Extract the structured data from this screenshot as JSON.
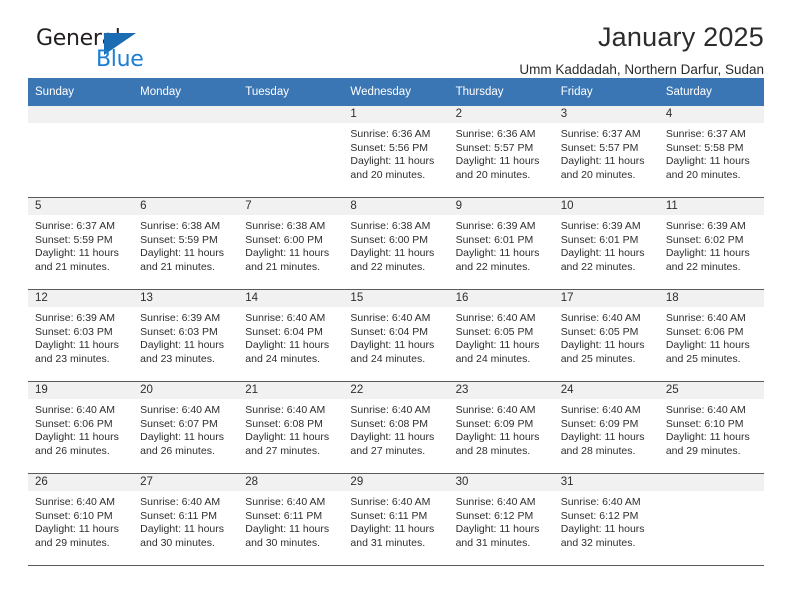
{
  "brand": {
    "line1": "General",
    "line2": "Blue",
    "triangle_icon": "blue-triangle-logo-mark",
    "color_dark": "#231f20",
    "color_blue": "#1b7fd4"
  },
  "header": {
    "title": "January 2025",
    "subtitle": "Umm Kaddadah, Northern Darfur, Sudan"
  },
  "theme": {
    "header_bg": "#3b76b4",
    "header_text": "#ffffff",
    "daynum_band_bg": "#f1f1f1",
    "grid_line": "#5a5a5a",
    "cell_bg": "#ffffff",
    "text": "#2e2e2e"
  },
  "weekday_headers": [
    "Sunday",
    "Monday",
    "Tuesday",
    "Wednesday",
    "Thursday",
    "Friday",
    "Saturday"
  ],
  "labels": {
    "sunrise_prefix": "Sunrise:",
    "sunset_prefix": "Sunset:",
    "daylight_prefix": "Daylight:"
  },
  "weeks": [
    [
      {
        "day": "",
        "empty": true
      },
      {
        "day": "",
        "empty": true
      },
      {
        "day": "",
        "empty": true
      },
      {
        "day": "1",
        "sunrise": "Sunrise: 6:36 AM",
        "sunset": "Sunset: 5:56 PM",
        "daylight_l1": "Daylight: 11 hours",
        "daylight_l2": "and 20 minutes."
      },
      {
        "day": "2",
        "sunrise": "Sunrise: 6:36 AM",
        "sunset": "Sunset: 5:57 PM",
        "daylight_l1": "Daylight: 11 hours",
        "daylight_l2": "and 20 minutes."
      },
      {
        "day": "3",
        "sunrise": "Sunrise: 6:37 AM",
        "sunset": "Sunset: 5:57 PM",
        "daylight_l1": "Daylight: 11 hours",
        "daylight_l2": "and 20 minutes."
      },
      {
        "day": "4",
        "sunrise": "Sunrise: 6:37 AM",
        "sunset": "Sunset: 5:58 PM",
        "daylight_l1": "Daylight: 11 hours",
        "daylight_l2": "and 20 minutes."
      }
    ],
    [
      {
        "day": "5",
        "sunrise": "Sunrise: 6:37 AM",
        "sunset": "Sunset: 5:59 PM",
        "daylight_l1": "Daylight: 11 hours",
        "daylight_l2": "and 21 minutes."
      },
      {
        "day": "6",
        "sunrise": "Sunrise: 6:38 AM",
        "sunset": "Sunset: 5:59 PM",
        "daylight_l1": "Daylight: 11 hours",
        "daylight_l2": "and 21 minutes."
      },
      {
        "day": "7",
        "sunrise": "Sunrise: 6:38 AM",
        "sunset": "Sunset: 6:00 PM",
        "daylight_l1": "Daylight: 11 hours",
        "daylight_l2": "and 21 minutes."
      },
      {
        "day": "8",
        "sunrise": "Sunrise: 6:38 AM",
        "sunset": "Sunset: 6:00 PM",
        "daylight_l1": "Daylight: 11 hours",
        "daylight_l2": "and 22 minutes."
      },
      {
        "day": "9",
        "sunrise": "Sunrise: 6:39 AM",
        "sunset": "Sunset: 6:01 PM",
        "daylight_l1": "Daylight: 11 hours",
        "daylight_l2": "and 22 minutes."
      },
      {
        "day": "10",
        "sunrise": "Sunrise: 6:39 AM",
        "sunset": "Sunset: 6:01 PM",
        "daylight_l1": "Daylight: 11 hours",
        "daylight_l2": "and 22 minutes."
      },
      {
        "day": "11",
        "sunrise": "Sunrise: 6:39 AM",
        "sunset": "Sunset: 6:02 PM",
        "daylight_l1": "Daylight: 11 hours",
        "daylight_l2": "and 22 minutes."
      }
    ],
    [
      {
        "day": "12",
        "sunrise": "Sunrise: 6:39 AM",
        "sunset": "Sunset: 6:03 PM",
        "daylight_l1": "Daylight: 11 hours",
        "daylight_l2": "and 23 minutes."
      },
      {
        "day": "13",
        "sunrise": "Sunrise: 6:39 AM",
        "sunset": "Sunset: 6:03 PM",
        "daylight_l1": "Daylight: 11 hours",
        "daylight_l2": "and 23 minutes."
      },
      {
        "day": "14",
        "sunrise": "Sunrise: 6:40 AM",
        "sunset": "Sunset: 6:04 PM",
        "daylight_l1": "Daylight: 11 hours",
        "daylight_l2": "and 24 minutes."
      },
      {
        "day": "15",
        "sunrise": "Sunrise: 6:40 AM",
        "sunset": "Sunset: 6:04 PM",
        "daylight_l1": "Daylight: 11 hours",
        "daylight_l2": "and 24 minutes."
      },
      {
        "day": "16",
        "sunrise": "Sunrise: 6:40 AM",
        "sunset": "Sunset: 6:05 PM",
        "daylight_l1": "Daylight: 11 hours",
        "daylight_l2": "and 24 minutes."
      },
      {
        "day": "17",
        "sunrise": "Sunrise: 6:40 AM",
        "sunset": "Sunset: 6:05 PM",
        "daylight_l1": "Daylight: 11 hours",
        "daylight_l2": "and 25 minutes."
      },
      {
        "day": "18",
        "sunrise": "Sunrise: 6:40 AM",
        "sunset": "Sunset: 6:06 PM",
        "daylight_l1": "Daylight: 11 hours",
        "daylight_l2": "and 25 minutes."
      }
    ],
    [
      {
        "day": "19",
        "sunrise": "Sunrise: 6:40 AM",
        "sunset": "Sunset: 6:06 PM",
        "daylight_l1": "Daylight: 11 hours",
        "daylight_l2": "and 26 minutes."
      },
      {
        "day": "20",
        "sunrise": "Sunrise: 6:40 AM",
        "sunset": "Sunset: 6:07 PM",
        "daylight_l1": "Daylight: 11 hours",
        "daylight_l2": "and 26 minutes."
      },
      {
        "day": "21",
        "sunrise": "Sunrise: 6:40 AM",
        "sunset": "Sunset: 6:08 PM",
        "daylight_l1": "Daylight: 11 hours",
        "daylight_l2": "and 27 minutes."
      },
      {
        "day": "22",
        "sunrise": "Sunrise: 6:40 AM",
        "sunset": "Sunset: 6:08 PM",
        "daylight_l1": "Daylight: 11 hours",
        "daylight_l2": "and 27 minutes."
      },
      {
        "day": "23",
        "sunrise": "Sunrise: 6:40 AM",
        "sunset": "Sunset: 6:09 PM",
        "daylight_l1": "Daylight: 11 hours",
        "daylight_l2": "and 28 minutes."
      },
      {
        "day": "24",
        "sunrise": "Sunrise: 6:40 AM",
        "sunset": "Sunset: 6:09 PM",
        "daylight_l1": "Daylight: 11 hours",
        "daylight_l2": "and 28 minutes."
      },
      {
        "day": "25",
        "sunrise": "Sunrise: 6:40 AM",
        "sunset": "Sunset: 6:10 PM",
        "daylight_l1": "Daylight: 11 hours",
        "daylight_l2": "and 29 minutes."
      }
    ],
    [
      {
        "day": "26",
        "sunrise": "Sunrise: 6:40 AM",
        "sunset": "Sunset: 6:10 PM",
        "daylight_l1": "Daylight: 11 hours",
        "daylight_l2": "and 29 minutes."
      },
      {
        "day": "27",
        "sunrise": "Sunrise: 6:40 AM",
        "sunset": "Sunset: 6:11 PM",
        "daylight_l1": "Daylight: 11 hours",
        "daylight_l2": "and 30 minutes."
      },
      {
        "day": "28",
        "sunrise": "Sunrise: 6:40 AM",
        "sunset": "Sunset: 6:11 PM",
        "daylight_l1": "Daylight: 11 hours",
        "daylight_l2": "and 30 minutes."
      },
      {
        "day": "29",
        "sunrise": "Sunrise: 6:40 AM",
        "sunset": "Sunset: 6:11 PM",
        "daylight_l1": "Daylight: 11 hours",
        "daylight_l2": "and 31 minutes."
      },
      {
        "day": "30",
        "sunrise": "Sunrise: 6:40 AM",
        "sunset": "Sunset: 6:12 PM",
        "daylight_l1": "Daylight: 11 hours",
        "daylight_l2": "and 31 minutes."
      },
      {
        "day": "31",
        "sunrise": "Sunrise: 6:40 AM",
        "sunset": "Sunset: 6:12 PM",
        "daylight_l1": "Daylight: 11 hours",
        "daylight_l2": "and 32 minutes."
      },
      {
        "day": "",
        "empty": true
      }
    ]
  ]
}
